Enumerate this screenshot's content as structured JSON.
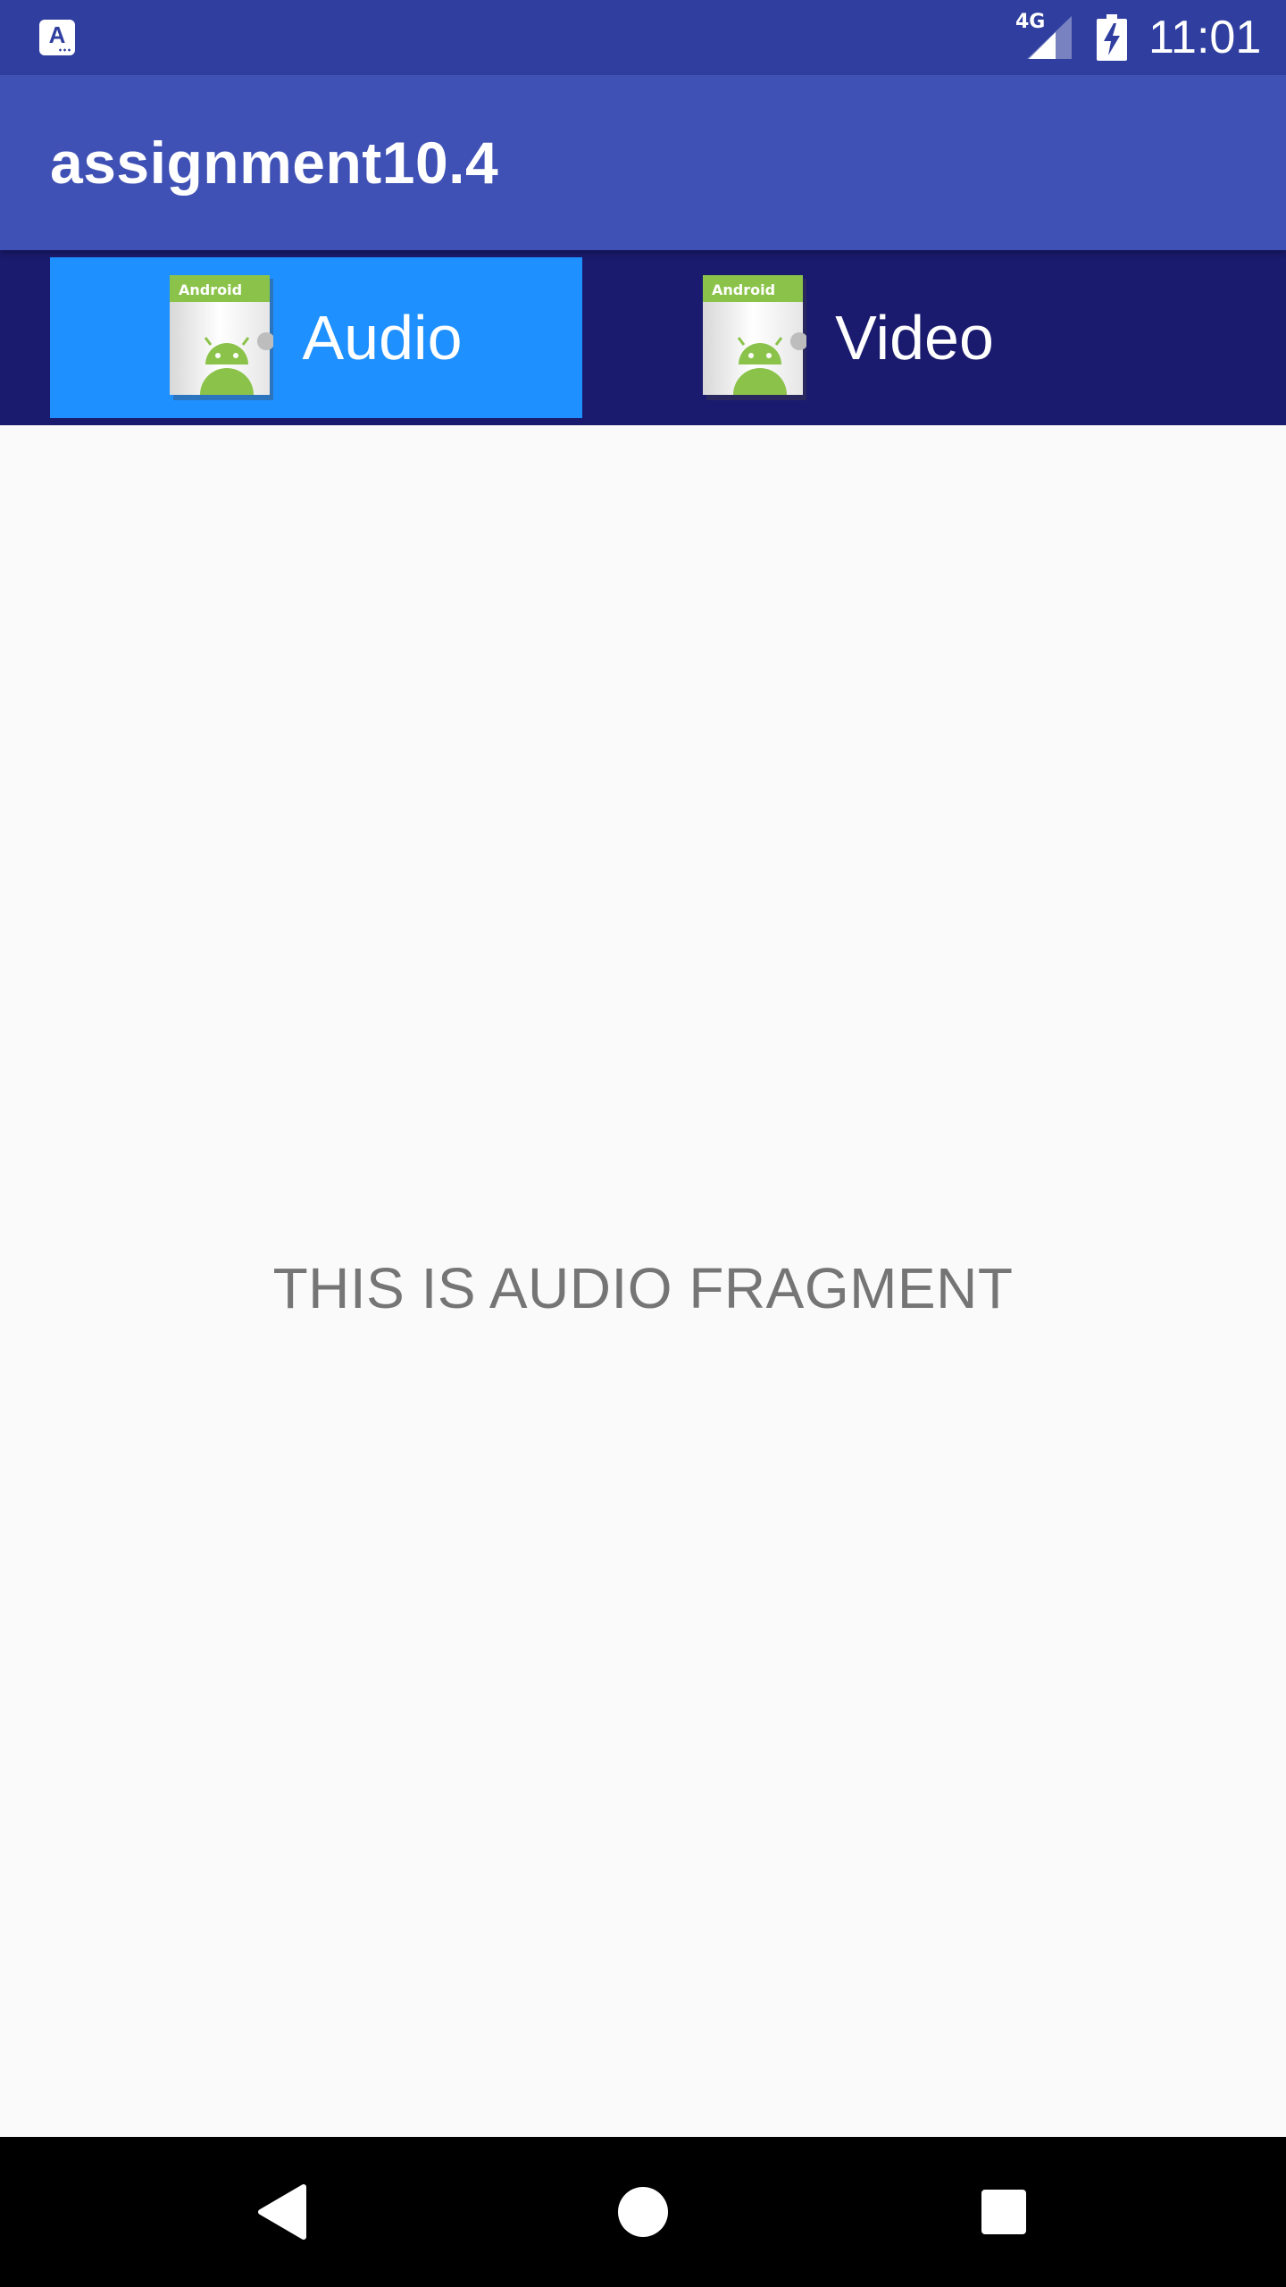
{
  "status_bar": {
    "notification_icon": "app-notification-icon",
    "notification_glyph": "A",
    "network_type": "4G",
    "signal_icon": "cell-signal-icon",
    "battery_icon": "battery-charging-icon",
    "time": "11:01"
  },
  "app_bar": {
    "title": "assignment10.4"
  },
  "tabs": [
    {
      "label": "Audio",
      "icon": "android-icon",
      "selected": true
    },
    {
      "label": "Video",
      "icon": "android-icon",
      "selected": false
    }
  ],
  "content": {
    "message": "THIS IS AUDIO FRAGMENT"
  },
  "nav_bar": {
    "back_icon": "back-triangle-icon",
    "home_icon": "home-circle-icon",
    "recents_icon": "recents-square-icon"
  },
  "colors": {
    "status_bar": "#303f9f",
    "app_bar": "#3f51b5",
    "tab_bar": "#1a1a6e",
    "tab_selected": "#1e90ff",
    "content_bg": "#fafafa",
    "content_text": "#757575",
    "nav_bar": "#000000"
  }
}
